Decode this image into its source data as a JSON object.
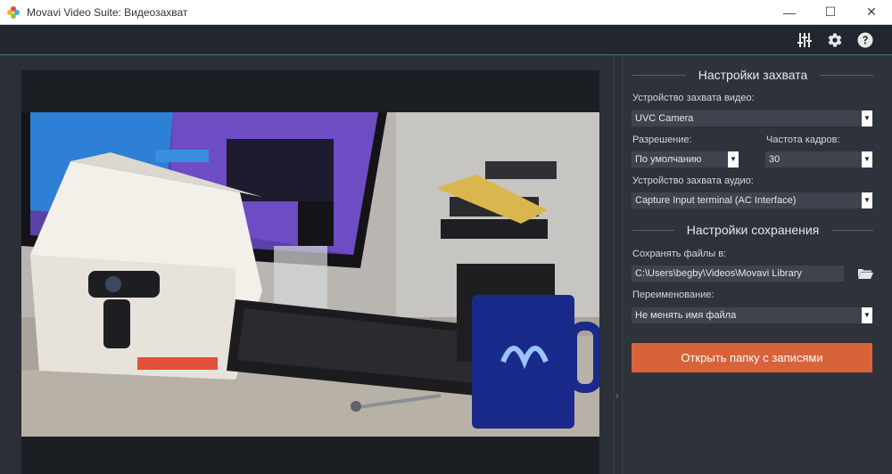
{
  "window": {
    "title": "Movavi Video Suite: Видеозахват",
    "minimize_glyph": "—",
    "maximize_glyph": "☐",
    "close_glyph": "✕"
  },
  "toolbar": {
    "icons": [
      "equalizer-icon",
      "gear-icon",
      "help-icon"
    ]
  },
  "settings": {
    "capture_header": "Настройки захвата",
    "video_device_label": "Устройство захвата видео:",
    "video_device_value": "UVC Camera",
    "resolution_label": "Разрешение:",
    "resolution_value": "По умолчанию",
    "framerate_label": "Частота кадров:",
    "framerate_value": "30",
    "audio_device_label": "Устройство захвата аудио:",
    "audio_device_value": "Capture Input terminal (AC Interface)",
    "save_header": "Настройки сохранения",
    "save_files_label": "Сохранять файлы в:",
    "save_path_value": "C:\\Users\\begby\\Videos\\Movavi Library",
    "rename_label": "Переименование:",
    "rename_value": "Не менять имя файла",
    "open_folder_button": "Открыть папку с записями"
  },
  "colors": {
    "accent": "#d8623a",
    "panel_bg": "#2e323b",
    "toolbar_bg": "#22262e",
    "field_bg": "#3e434d"
  }
}
